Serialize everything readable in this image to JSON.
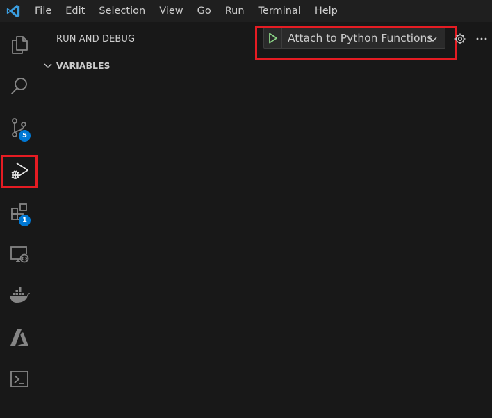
{
  "menu": {
    "items": [
      "File",
      "Edit",
      "Selection",
      "View",
      "Go",
      "Run",
      "Terminal",
      "Help"
    ]
  },
  "activitybar": {
    "items": [
      {
        "name": "explorer",
        "icon": "files-icon"
      },
      {
        "name": "search",
        "icon": "search-icon"
      },
      {
        "name": "source-control",
        "icon": "source-control-icon",
        "badge": "5"
      },
      {
        "name": "run-and-debug",
        "icon": "run-debug-icon",
        "active": true
      },
      {
        "name": "extensions",
        "icon": "extensions-icon",
        "badge": "1"
      },
      {
        "name": "remote-explorer",
        "icon": "remote-explorer-icon"
      },
      {
        "name": "docker",
        "icon": "docker-icon"
      },
      {
        "name": "azure",
        "icon": "azure-icon"
      },
      {
        "name": "powershell",
        "icon": "terminal-icon"
      }
    ]
  },
  "sidebar": {
    "title": "RUN AND DEBUG",
    "launch_config": "Attach to Python Functions",
    "sections": [
      {
        "label": "VARIABLES",
        "expanded": true
      }
    ]
  },
  "colors": {
    "highlight": "#e51c23",
    "badge": "#0078d4",
    "play": "#89d185",
    "logo": "#3b9ddf"
  }
}
